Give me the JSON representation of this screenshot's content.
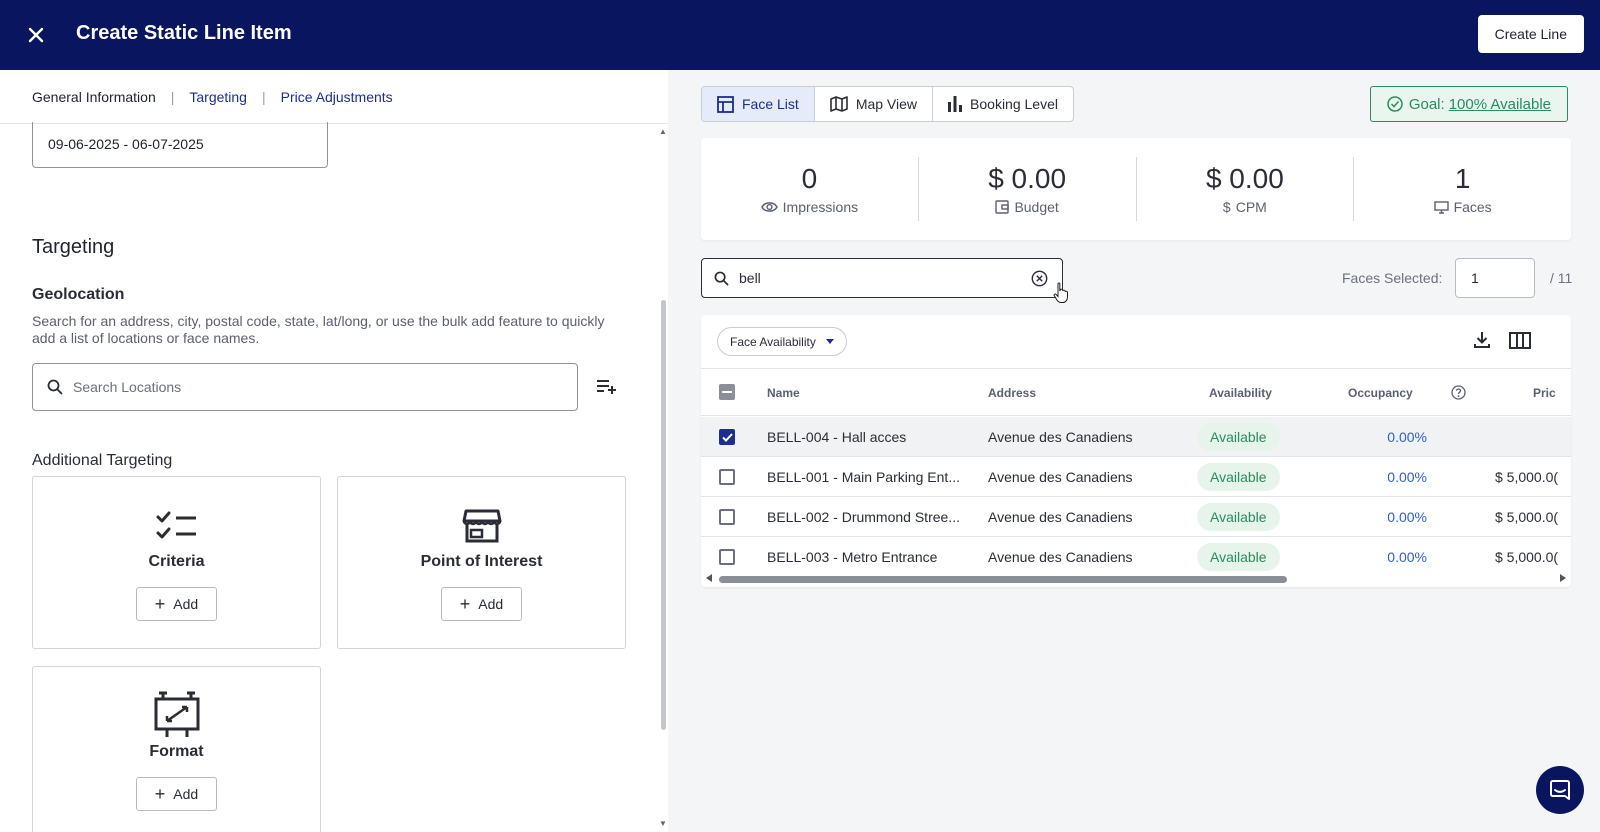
{
  "header": {
    "title": "Create Static Line Item",
    "create_label": "Create Line"
  },
  "left_tabs": {
    "general": "General Information",
    "targeting": "Targeting",
    "price": "Price Adjustments"
  },
  "form": {
    "date_range": "09-06-2025 - 06-07-2025",
    "section_title": "Targeting",
    "geo_title": "Geolocation",
    "geo_desc": "Search for an address, city, postal code, state, lat/long, or use the bulk add feature to quickly add a list of locations or face names.",
    "search_placeholder": "Search Locations",
    "additional_title": "Additional Targeting",
    "cards": [
      {
        "label": "Criteria",
        "icon": "checklist-icon",
        "add": "Add"
      },
      {
        "label": "Point of Interest",
        "icon": "storefront-icon",
        "add": "Add"
      },
      {
        "label": "Format",
        "icon": "billboard-icon",
        "add": "Add"
      }
    ]
  },
  "views": {
    "face_list": "Face List",
    "map_view": "Map View",
    "booking_level": "Booking Level"
  },
  "goal": {
    "prefix": "Goal:",
    "value": "100% Available"
  },
  "stats": [
    {
      "value": "0",
      "label": "Impressions",
      "icon": "eye-icon"
    },
    {
      "value": "$ 0.00",
      "label": "Budget",
      "icon": "wallet-icon"
    },
    {
      "value": "$ 0.00",
      "label": "CPM",
      "icon": "dollar-icon"
    },
    {
      "value": "1",
      "label": "Faces",
      "icon": "monitor-icon"
    }
  ],
  "face_search": {
    "value": "bell",
    "selected_label": "Faces Selected:",
    "selected_value": "1",
    "total": "/ 11"
  },
  "table": {
    "filter_label": "Face Availability",
    "columns": {
      "name": "Name",
      "address": "Address",
      "availability": "Availability",
      "occupancy": "Occupancy",
      "price": "Pric"
    },
    "rows": [
      {
        "name": "BELL-004 - Hall acces",
        "address": "Avenue des Canadiens",
        "availability": "Available",
        "occupancy": "0.00%",
        "price": "",
        "checked": true
      },
      {
        "name": "BELL-001 - Main Parking Ent...",
        "address": "Avenue des Canadiens",
        "availability": "Available",
        "occupancy": "0.00%",
        "price": "$ 5,000.0(",
        "checked": false
      },
      {
        "name": "BELL-002 - Drummond Stree...",
        "address": "Avenue des Canadiens",
        "availability": "Available",
        "occupancy": "0.00%",
        "price": "$ 5,000.0(",
        "checked": false
      },
      {
        "name": "BELL-003 - Metro Entrance",
        "address": "Avenue des Canadiens",
        "availability": "Available",
        "occupancy": "0.00%",
        "price": "$ 5,000.0(",
        "checked": false
      }
    ]
  },
  "colors": {
    "brand": "#0a1560",
    "accent": "#1c2d93",
    "success": "#2d8a5d"
  }
}
